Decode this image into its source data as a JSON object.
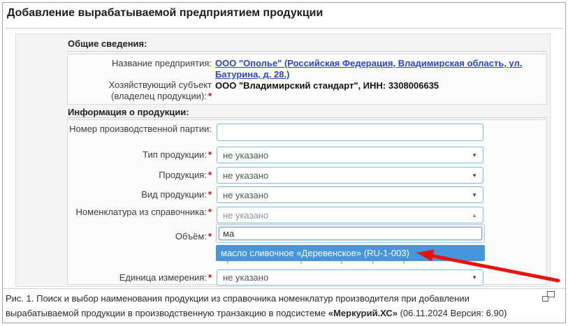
{
  "colors": {
    "link_blue": "#2946cd",
    "highlight_blue": "#4796db",
    "annotation_red": "#e8120f",
    "input_border_blue": "#7cbbe2",
    "required_red": "#e60000"
  },
  "window": {
    "title": "Добавление вырабатываемой предприятием продукции"
  },
  "general": {
    "heading": "Общие сведения:",
    "enterprise": {
      "label": "Название предприятия:",
      "link": "ООО \"Ополье\" (Российская Федерация, Владимирская область, ул. Батурина, д. 28.)"
    },
    "owner": {
      "label": "Хозяйствующий субъект (владелец продукции):",
      "required": "*",
      "value": "ООО \"Владимирский стандарт\", ИНН: 3308006635"
    }
  },
  "product": {
    "heading": "Информация о продукции:",
    "batch": {
      "label": "Номер производственной партии:",
      "value": ""
    },
    "type": {
      "label": "Тип продукции:",
      "required": "*",
      "value": "не указано"
    },
    "prod": {
      "label": "Продукция:",
      "required": "*",
      "value": "не указано"
    },
    "kind": {
      "label": "Вид продукции:",
      "required": "*",
      "value": "не указано"
    },
    "nomenclature": {
      "label": "Номенклатура из справочника:",
      "required": "*",
      "value": "не указано",
      "search": "ма",
      "option": "масло сливочное «Деревенское» (RU-1-003)"
    },
    "volume": {
      "label": "Объём:",
      "required": "*"
    },
    "unit": {
      "label": "Единица измерения:",
      "required": "*",
      "value": "не указано"
    }
  },
  "icons": {
    "dropdown_arrow": "▼",
    "dropup_arrow": "▲"
  },
  "caption": {
    "before": "Рис. 1. Поиск и выбор наименования продукции из справочника номенклатур производителя при добавлении вырабатываемой продукции в производственную транзакцию в подсистеме ",
    "bold": "«Меркурий.ХС»",
    "after": " (06.11.2024 Версия: 6.90)"
  }
}
